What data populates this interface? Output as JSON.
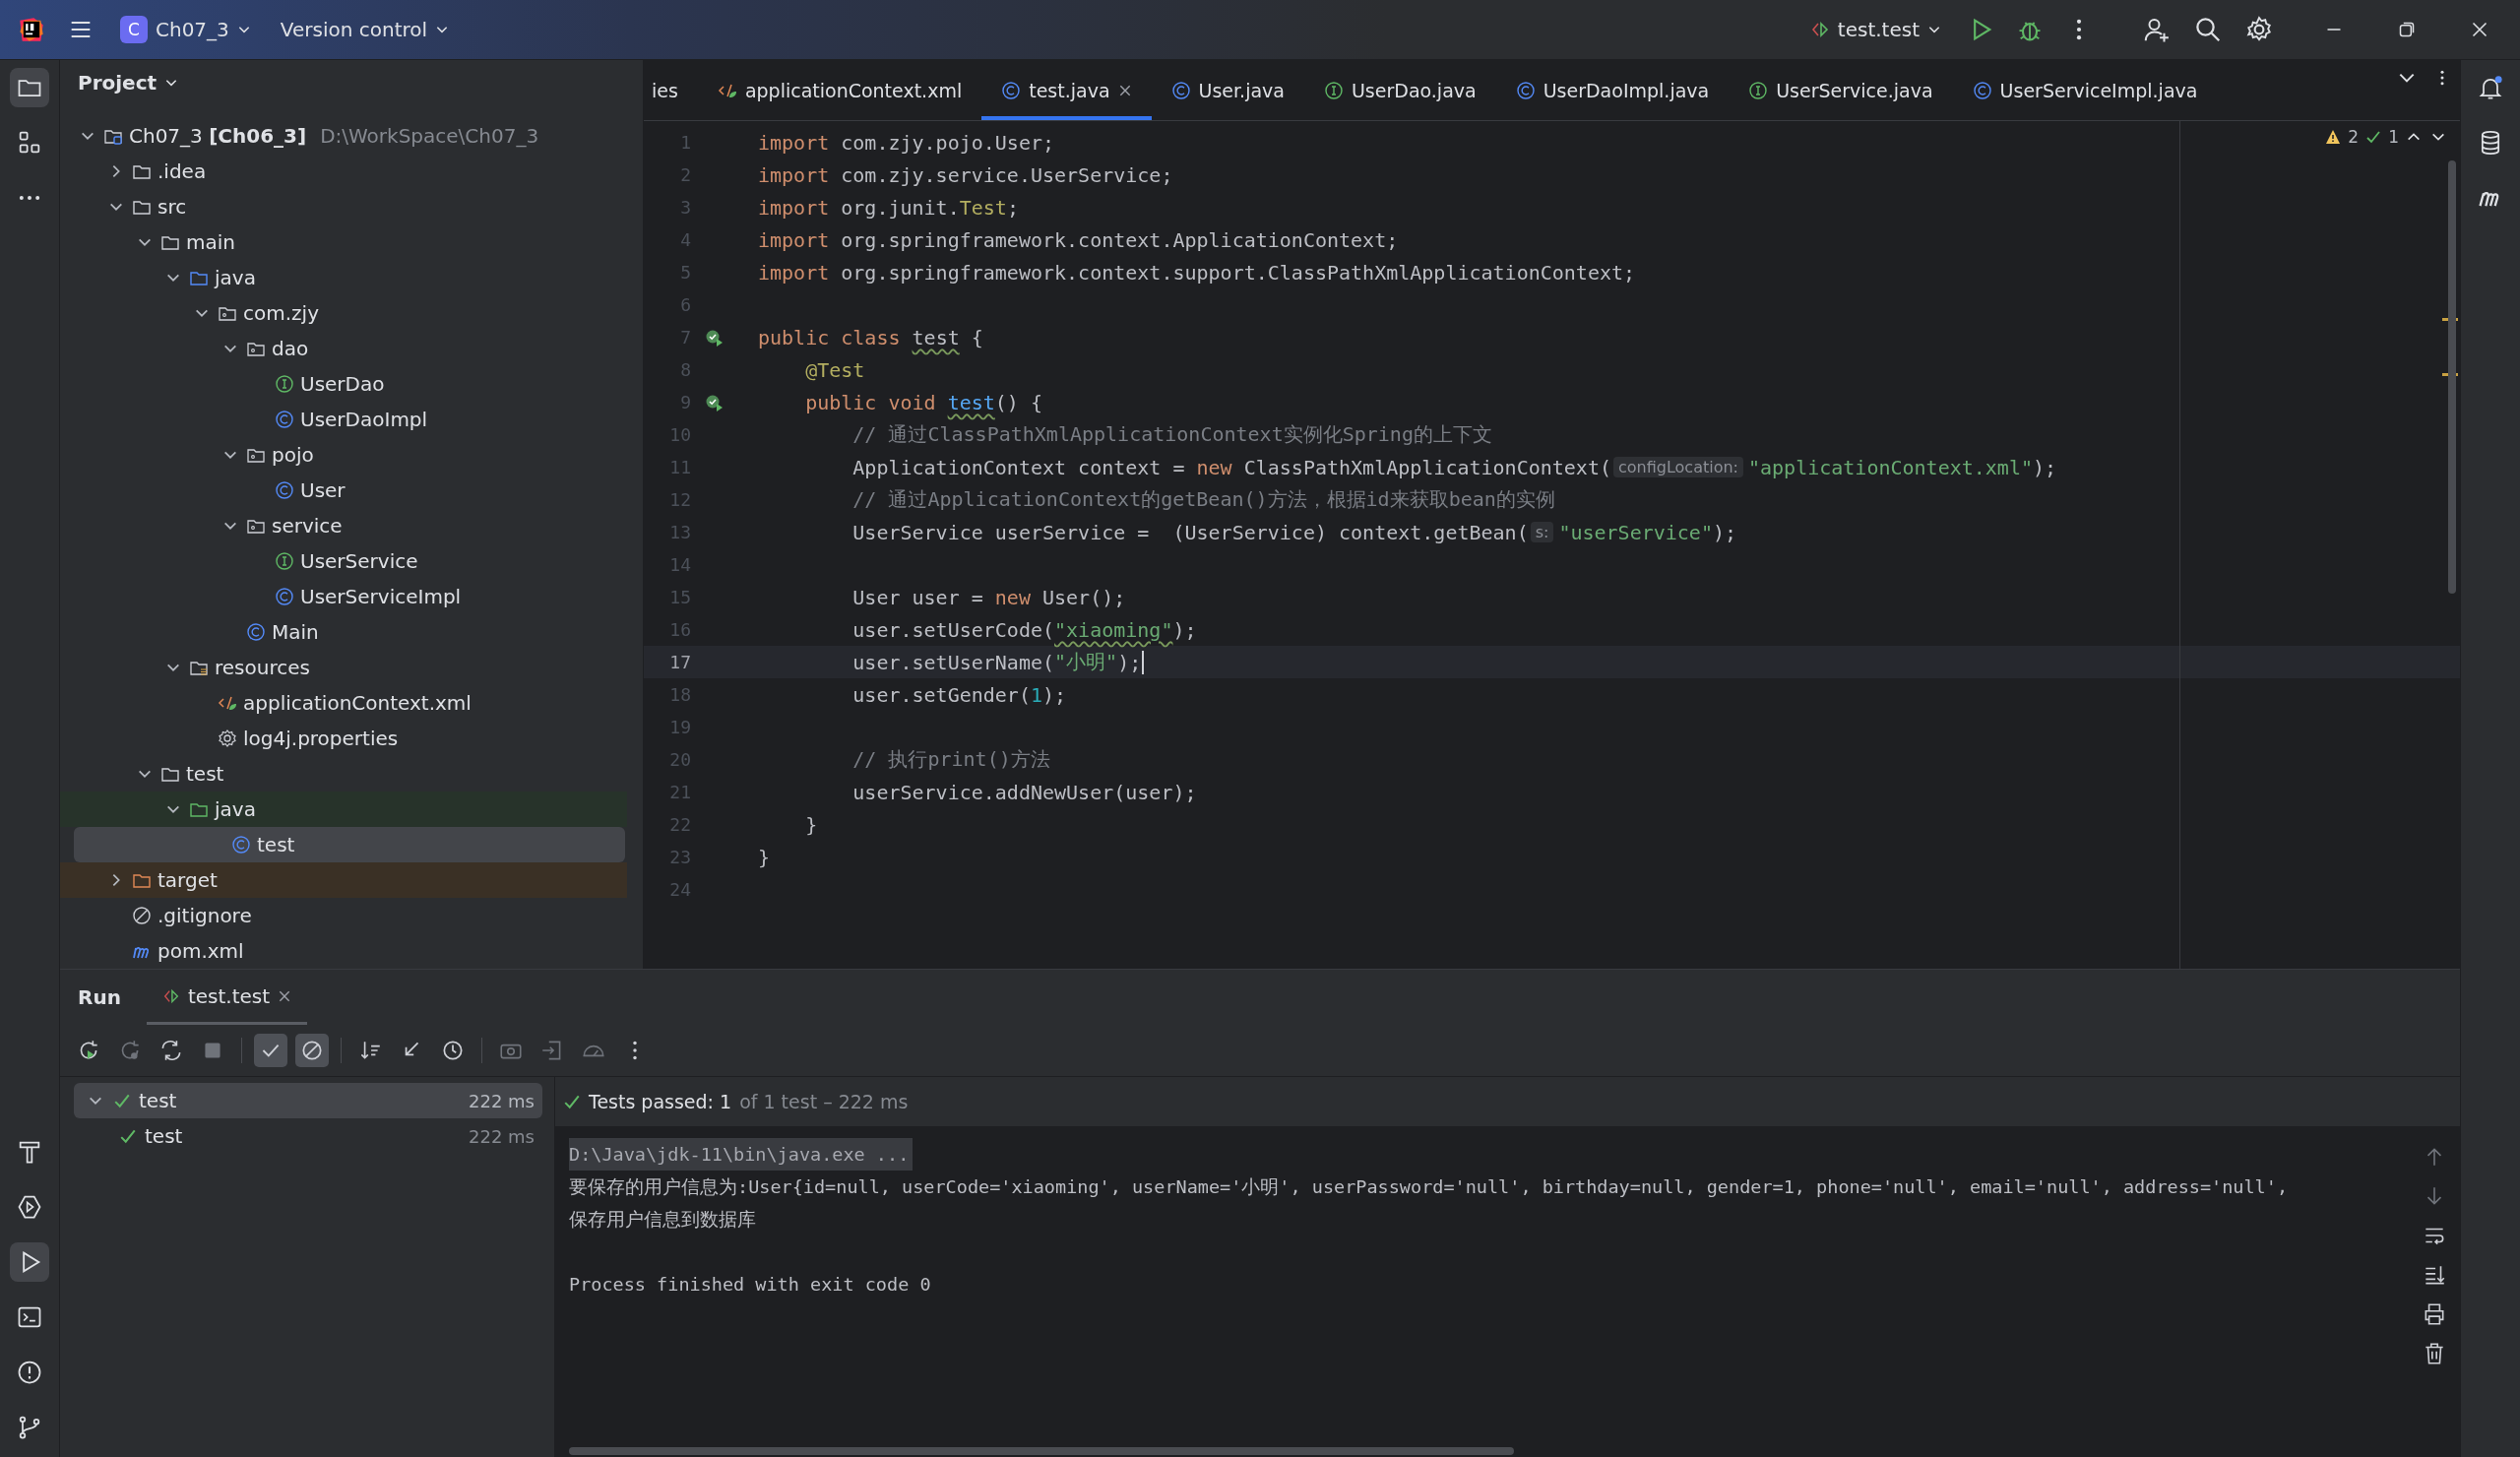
{
  "title_bar": {
    "project_badge": "C",
    "project_name": "Ch07_3",
    "vcs": "Version control",
    "run_config": "test.test"
  },
  "project_panel": {
    "title": "Project",
    "tree": [
      {
        "label": "Ch07_3 **[Ch06_3]**",
        "path": "D:\\WorkSpace\\Ch07_3",
        "kind": "module",
        "expanded": true,
        "selected": false,
        "children": [
          {
            "label": ".idea",
            "kind": "folder",
            "expanded": false,
            "selected": false
          },
          {
            "label": "src",
            "kind": "folder",
            "expanded": true,
            "selected": false,
            "children": [
              {
                "label": "main",
                "kind": "folder",
                "expanded": true,
                "selected": false,
                "children": [
                  {
                    "label": "java",
                    "kind": "source-root",
                    "expanded": true,
                    "selected": false,
                    "children": [
                      {
                        "label": "com.zjy",
                        "kind": "package",
                        "expanded": true,
                        "selected": false,
                        "children": [
                          {
                            "label": "dao",
                            "kind": "package",
                            "expanded": true,
                            "selected": false,
                            "children": [
                              {
                                "label": "UserDao",
                                "kind": "interface",
                                "selected": false
                              },
                              {
                                "label": "UserDaoImpl",
                                "kind": "class",
                                "selected": false
                              }
                            ]
                          },
                          {
                            "label": "pojo",
                            "kind": "package",
                            "expanded": true,
                            "selected": false,
                            "children": [
                              {
                                "label": "User",
                                "kind": "class",
                                "selected": false
                              }
                            ]
                          },
                          {
                            "label": "service",
                            "kind": "package",
                            "expanded": true,
                            "selected": false,
                            "children": [
                              {
                                "label": "UserService",
                                "kind": "interface",
                                "selected": false
                              },
                              {
                                "label": "UserServiceImpl",
                                "kind": "class",
                                "selected": false
                              }
                            ]
                          },
                          {
                            "label": "Main",
                            "kind": "class",
                            "selected": false
                          }
                        ]
                      }
                    ]
                  },
                  {
                    "label": "resources",
                    "kind": "resources",
                    "expanded": true,
                    "selected": false,
                    "children": [
                      {
                        "label": "applicationContext.xml",
                        "kind": "xml",
                        "selected": false
                      },
                      {
                        "label": "log4j.properties",
                        "kind": "properties",
                        "selected": false
                      }
                    ]
                  }
                ]
              },
              {
                "label": "test",
                "kind": "folder",
                "expanded": true,
                "selected": false,
                "children": [
                  {
                    "label": "java",
                    "kind": "test-root",
                    "expanded": true,
                    "selected": false,
                    "children": [
                      {
                        "label": "test",
                        "kind": "class",
                        "selected": true
                      }
                    ]
                  }
                ]
              }
            ]
          },
          {
            "label": "target",
            "kind": "excluded",
            "expanded": false,
            "selected": false
          },
          {
            "label": ".gitignore",
            "kind": "ignore",
            "selected": false
          },
          {
            "label": "pom.xml",
            "kind": "maven",
            "selected": false
          }
        ]
      }
    ]
  },
  "editor": {
    "tabs": [
      {
        "label": "ies",
        "selected": false
      },
      {
        "label": "applicationContext.xml",
        "kind": "xml",
        "selected": false
      },
      {
        "label": "test.java",
        "kind": "class",
        "selected": true
      },
      {
        "label": "User.java",
        "kind": "class",
        "selected": false
      },
      {
        "label": "UserDao.java",
        "kind": "interface",
        "selected": false
      },
      {
        "label": "UserDaoImpl.java",
        "kind": "class",
        "selected": false
      },
      {
        "label": "UserService.java",
        "kind": "interface",
        "selected": false
      },
      {
        "label": "UserServiceImpl.java",
        "kind": "class",
        "selected": false
      }
    ],
    "inspections": {
      "warnings": "2",
      "passed": "1"
    },
    "lines": [
      {
        "number": "1",
        "run_marker": false,
        "current": false,
        "tokens": [
          {
            "t": "import",
            "kind": "kw"
          },
          {
            "t": " com.zjy.pojo.User;",
            "kind": "plain"
          }
        ]
      },
      {
        "number": "2",
        "run_marker": false,
        "current": false,
        "tokens": [
          {
            "t": "import",
            "kind": "kw"
          },
          {
            "t": " com.zjy.service.UserService;",
            "kind": "plain"
          }
        ]
      },
      {
        "number": "3",
        "run_marker": false,
        "current": false,
        "tokens": [
          {
            "t": "import",
            "kind": "kw"
          },
          {
            "t": " org.junit.",
            "kind": "plain"
          },
          {
            "t": "Test",
            "kind": "ann"
          },
          {
            "t": ";",
            "kind": "plain"
          }
        ]
      },
      {
        "number": "4",
        "run_marker": false,
        "current": false,
        "tokens": [
          {
            "t": "import",
            "kind": "kw"
          },
          {
            "t": " org.springframework.context.ApplicationContext;",
            "kind": "plain"
          }
        ]
      },
      {
        "number": "5",
        "run_marker": false,
        "current": false,
        "tokens": [
          {
            "t": "import",
            "kind": "kw"
          },
          {
            "t": " org.springframework.context.support.ClassPathXmlApplicationContext;",
            "kind": "plain"
          }
        ]
      },
      {
        "number": "6",
        "run_marker": false,
        "current": false
      },
      {
        "number": "7",
        "run_marker": true,
        "current": false,
        "tokens": [
          {
            "t": "public class ",
            "kind": "kw"
          },
          {
            "t": "test",
            "kind": "warn"
          },
          {
            "t": " {",
            "kind": "plain"
          }
        ]
      },
      {
        "number": "8",
        "run_marker": false,
        "current": false,
        "tokens": [
          {
            "t": "    @Test",
            "kind": "ann"
          }
        ]
      },
      {
        "number": "9",
        "run_marker": true,
        "current": false,
        "tokens": [
          {
            "t": "    public void ",
            "kind": "kw"
          },
          {
            "t": "test",
            "kind": "decl-warn"
          },
          {
            "t": "() {",
            "kind": "plain"
          }
        ]
      },
      {
        "number": "10",
        "run_marker": false,
        "current": false,
        "tokens": [
          {
            "t": "        // 通过ClassPathXmlApplicationContext实例化Spring的上下文",
            "kind": "cmt"
          }
        ]
      },
      {
        "number": "11",
        "run_marker": false,
        "current": false,
        "tokens": [
          {
            "t": "        ApplicationContext context = ",
            "kind": "plain"
          },
          {
            "t": "new",
            "kind": "kw"
          },
          {
            "t": " ClassPathXmlApplicationContext(",
            "kind": "plain"
          },
          {
            "t": "configLocation:",
            "kind": "hint"
          },
          {
            "t": "\"applicationContext.xml\"",
            "kind": "str"
          },
          {
            "t": ");",
            "kind": "plain"
          }
        ]
      },
      {
        "number": "12",
        "run_marker": false,
        "current": false,
        "tokens": [
          {
            "t": "        // 通过ApplicationContext的getBean()方法，根据id来获取bean的实例",
            "kind": "cmt"
          }
        ]
      },
      {
        "number": "13",
        "run_marker": false,
        "current": false,
        "tokens": [
          {
            "t": "        UserService userService =  (UserService) context.getBean(",
            "kind": "plain"
          },
          {
            "t": "s:",
            "kind": "hint"
          },
          {
            "t": "\"userService\"",
            "kind": "str"
          },
          {
            "t": ");",
            "kind": "plain"
          }
        ]
      },
      {
        "number": "14",
        "run_marker": false,
        "current": false
      },
      {
        "number": "15",
        "run_marker": false,
        "current": false,
        "tokens": [
          {
            "t": "        User user = ",
            "kind": "plain"
          },
          {
            "t": "new",
            "kind": "kw"
          },
          {
            "t": " User();",
            "kind": "plain"
          }
        ]
      },
      {
        "number": "16",
        "run_marker": false,
        "current": false,
        "tokens": [
          {
            "t": "        user.setUserCode(",
            "kind": "plain"
          },
          {
            "t": "\"xiaoming\"",
            "kind": "str-typo"
          },
          {
            "t": ");",
            "kind": "plain"
          }
        ]
      },
      {
        "number": "17",
        "run_marker": false,
        "current": true,
        "tokens": [
          {
            "t": "        user.setUserName(",
            "kind": "plain"
          },
          {
            "t": "\"小明\"",
            "kind": "str"
          },
          {
            "t": ");",
            "kind": "plain"
          }
        ]
      },
      {
        "number": "18",
        "run_marker": false,
        "current": false,
        "tokens": [
          {
            "t": "        user.setGender(",
            "kind": "plain"
          },
          {
            "t": "1",
            "kind": "num"
          },
          {
            "t": ");",
            "kind": "plain"
          }
        ]
      },
      {
        "number": "19",
        "run_marker": false,
        "current": false
      },
      {
        "number": "20",
        "run_marker": false,
        "current": false,
        "tokens": [
          {
            "t": "        // 执行print()方法",
            "kind": "cmt"
          }
        ]
      },
      {
        "number": "21",
        "run_marker": false,
        "current": false,
        "tokens": [
          {
            "t": "        userService.addNewUser(user);",
            "kind": "plain"
          }
        ]
      },
      {
        "number": "22",
        "run_marker": false,
        "current": false,
        "tokens": [
          {
            "t": "    }",
            "kind": "plain"
          }
        ]
      },
      {
        "number": "23",
        "run_marker": false,
        "current": false,
        "tokens": [
          {
            "t": "}",
            "kind": "plain"
          }
        ]
      },
      {
        "number": "24",
        "run_marker": false,
        "current": false
      }
    ]
  },
  "run_panel": {
    "title": "Run",
    "tabs": [
      {
        "label": "test.test",
        "selected": true
      }
    ],
    "toolbar": {
      "show_passed": true,
      "show_ignored": true
    },
    "tests": [
      {
        "label": "test",
        "time": "222 ms",
        "passed": true,
        "expanded": true,
        "selected": true,
        "children": [
          {
            "label": "test",
            "time": "222 ms",
            "passed": true,
            "selected": false
          }
        ]
      }
    ],
    "summary": {
      "label": "Tests passed: 1",
      "detail": "of 1 test – 222 ms"
    },
    "console": [
      {
        "text": "D:\\Java\\jdk-11\\bin\\java.exe ...",
        "kind": "command"
      },
      {
        "text": "要保存的用户信息为:User{id=null, userCode='xiaoming', userName='小明', userPassword='null', birthday=null, gender=1, phone='null', email='null', address='null',",
        "kind": "output"
      },
      {
        "text": "保存用户信息到数据库",
        "kind": "output"
      },
      {
        "text": "Process finished with exit code 0",
        "kind": "exit"
      }
    ]
  }
}
